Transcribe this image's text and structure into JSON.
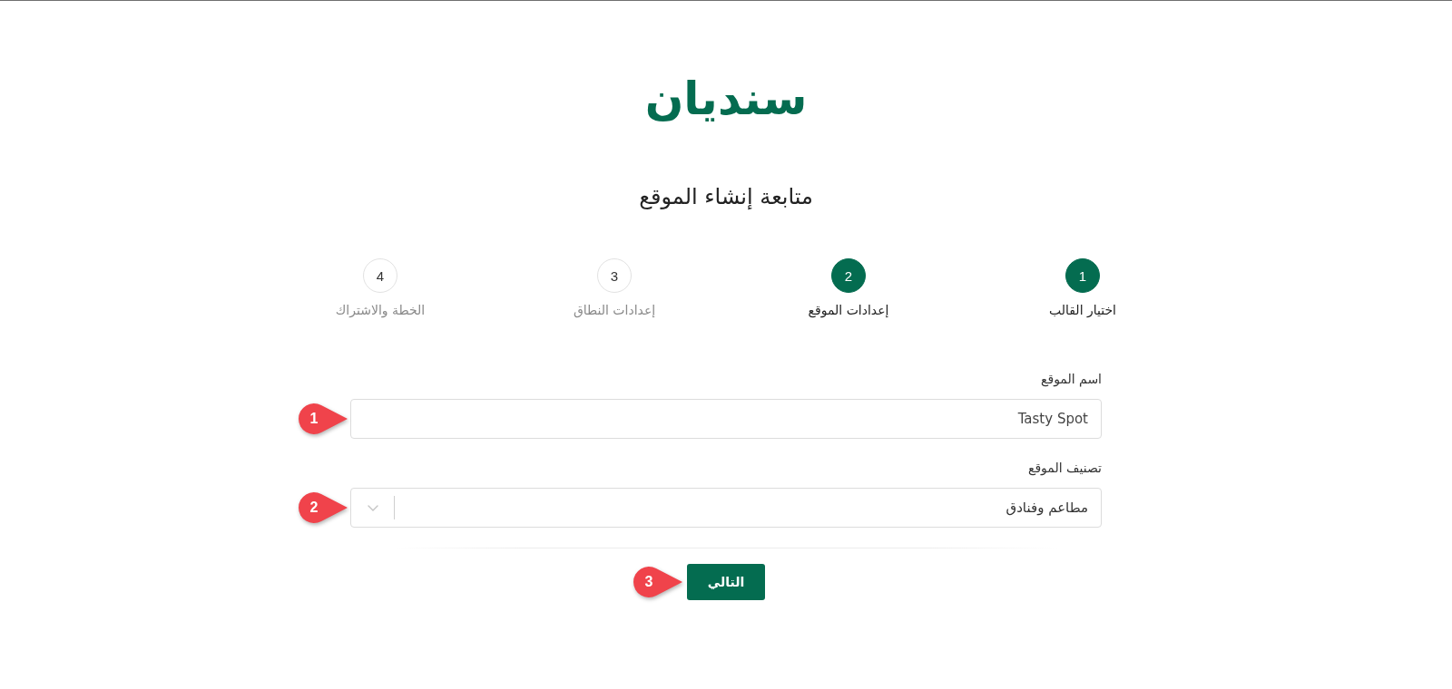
{
  "logo": {
    "text": "سنديان"
  },
  "title": "متابعة إنشاء الموقع",
  "steps": [
    {
      "number": "1",
      "label": "اختيار القالب",
      "active": true
    },
    {
      "number": "2",
      "label": "إعدادات الموقع",
      "active": true
    },
    {
      "number": "3",
      "label": "إعدادات النطاق",
      "active": false
    },
    {
      "number": "4",
      "label": "الخطة والاشتراك",
      "active": false
    }
  ],
  "form": {
    "fields": [
      {
        "kind": "text",
        "label": "اسم الموقع",
        "value": "Tasty Spot",
        "callout": "1"
      },
      {
        "kind": "select",
        "label": "تصنيف الموقع",
        "value": "مطاعم وفنادق",
        "callout": "2"
      }
    ],
    "next_button": {
      "label": "التالي",
      "callout": "3"
    }
  }
}
